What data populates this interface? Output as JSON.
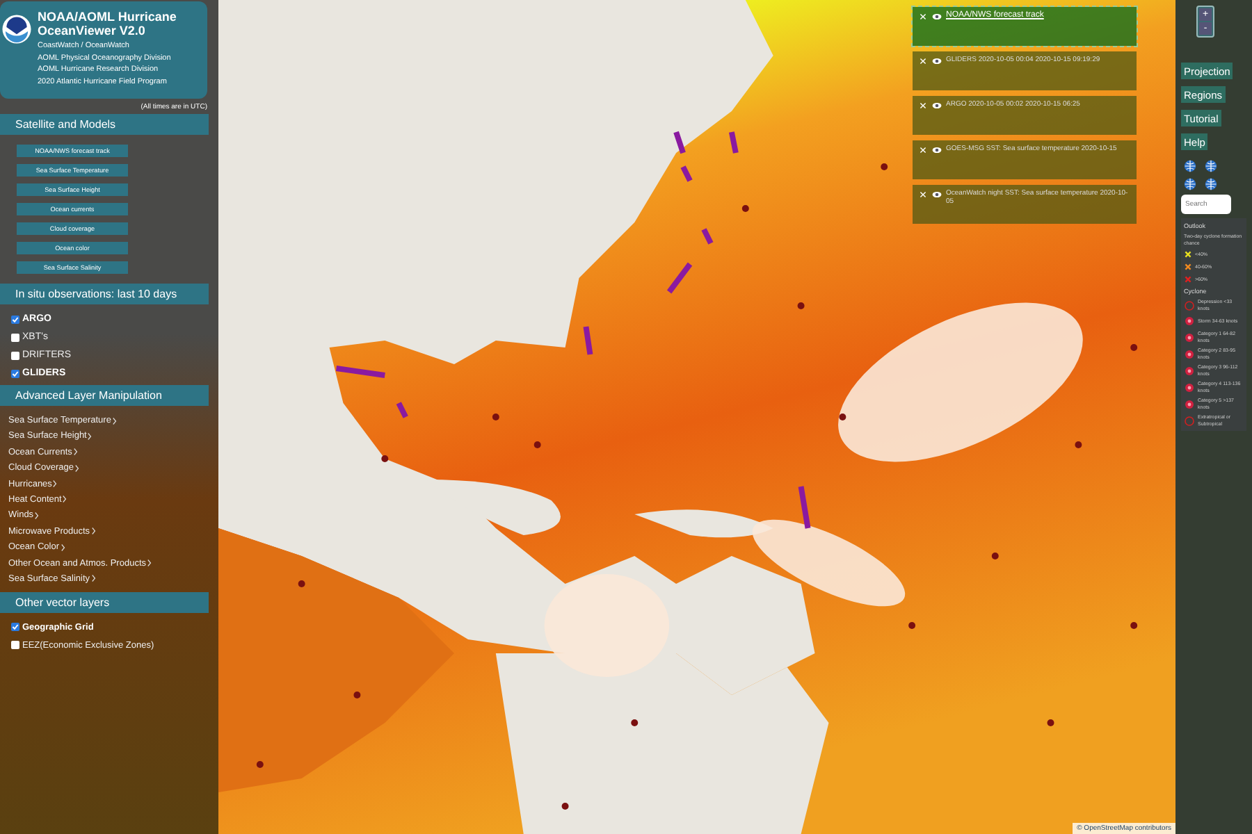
{
  "header": {
    "title": "NOAA/AOML Hurricane OceanViewer V2.0",
    "lines": [
      "CoastWatch / OceanWatch",
      "AOML Physical Oceanography Division",
      "AOML Hurricane Research Division",
      "2020 Atlantic Hurricane Field Program"
    ]
  },
  "time_note": "(All times are in UTC)",
  "satellite": {
    "heading": "Satellite and Models",
    "buttons": [
      "NOAA/NWS forecast track",
      "Sea Surface Temperature",
      "Sea Surface Height",
      "Ocean currents",
      "Cloud coverage",
      "Ocean color",
      "Sea Surface Salinity"
    ]
  },
  "in_situ": {
    "heading": "In situ observations: last 10 days",
    "items": [
      {
        "label": "ARGO",
        "checked": true
      },
      {
        "label": "XBT's",
        "checked": false
      },
      {
        "label": "DRIFTERS",
        "checked": false
      },
      {
        "label": "GLIDERS",
        "checked": true
      }
    ]
  },
  "advanced": {
    "heading": "Advanced Layer Manipulation",
    "items": [
      "Sea Surface Temperature",
      "Sea Surface Height",
      "Ocean Currents",
      "Cloud Coverage",
      "Hurricanes",
      "Heat Content",
      "Winds",
      "Microwave Products",
      "Ocean Color",
      "Other Ocean and Atmos. Products",
      "Sea Surface Salinity"
    ]
  },
  "vector": {
    "heading": "Other vector layers",
    "items": [
      {
        "label": "Geographic Grid",
        "checked": true
      },
      {
        "label": "EEZ(Economic Exclusive Zones)",
        "checked": false
      }
    ]
  },
  "layers": [
    {
      "label": "NOAA/NWS forecast track",
      "kind": "link"
    },
    {
      "label": "GLIDERS 2020-10-05 00:04 2020-10-15 09:19:29",
      "kind": "text"
    },
    {
      "label": "ARGO 2020-10-05 00:02 2020-10-15 06:25",
      "kind": "text"
    },
    {
      "label": "GOES-MSG SST: Sea surface temperature 2020-10-15",
      "kind": "text"
    },
    {
      "label": "OceanWatch night SST: Sea surface temperature 2020-10-05",
      "kind": "text"
    }
  ],
  "zoom": [
    "+",
    "-"
  ],
  "menu": [
    "Projection",
    "Regions",
    "Tutorial",
    "Help"
  ],
  "search": {
    "placeholder": "Search"
  },
  "legend": {
    "outlook_title": "Outlook",
    "outlook_note": "Two-day cyclone formation chance",
    "outlook": [
      {
        "label": "<40%",
        "color": "#e8e020"
      },
      {
        "label": "40-60%",
        "color": "#f08a20"
      },
      {
        "label": ">60%",
        "color": "#e02020"
      }
    ],
    "cyclone_title": "Cyclone",
    "cyclones": [
      {
        "label": "Depression <33 knots",
        "kind": "outline"
      },
      {
        "label": "Storm 34-63 knots",
        "kind": "filled"
      },
      {
        "label": "Category 1 64-82 knots",
        "kind": "filled"
      },
      {
        "label": "Category 2 83-95 knots",
        "kind": "filled"
      },
      {
        "label": "Category 3 96-112 knots",
        "kind": "filled"
      },
      {
        "label": "Category 4 113-136 knots",
        "kind": "filled"
      },
      {
        "label": "Category 5 >137 knots",
        "kind": "filled"
      },
      {
        "label": "Extratropical or Subtropical",
        "kind": "outline"
      }
    ]
  },
  "attribution": "© OpenStreetMap contributors"
}
